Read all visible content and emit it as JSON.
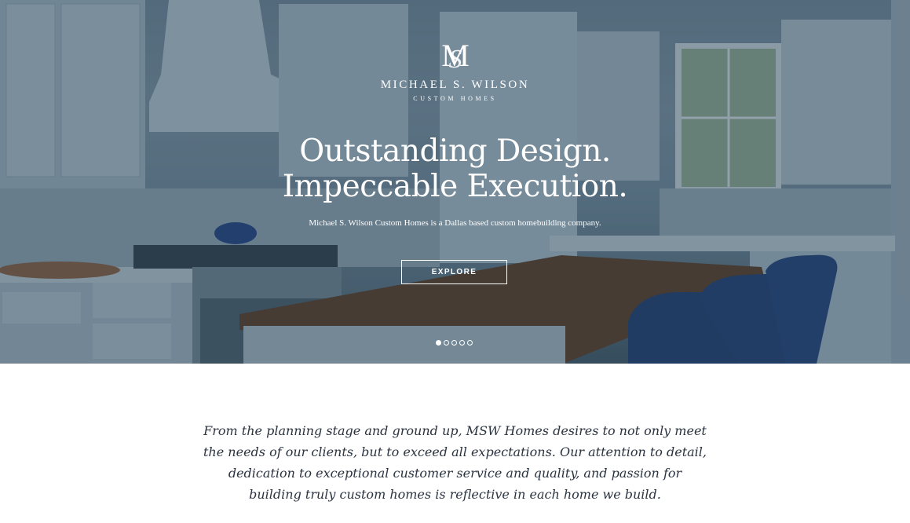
{
  "brand": {
    "monogram": "MSW",
    "name": "MICHAEL S. WILSON",
    "tagline": "CUSTOM HOMES"
  },
  "hero": {
    "headline_line1": "Outstanding Design.",
    "headline_line2": "Impeccable Execution.",
    "subline": "Michael S. Wilson Custom Homes is a Dallas based custom homebuilding company.",
    "cta_label": "EXPLORE",
    "slides": {
      "count": 5,
      "active": 1
    }
  },
  "intro": {
    "lines": [
      "From the planning stage and ground up, MSW Homes desires to not only meet",
      "the needs of our clients, but to exceed all expectations. Our attention to detail,",
      "dedication to exceptional customer service and quality, and passion for",
      "building truly custom homes is reflective in each home we build."
    ]
  },
  "colors": {
    "overlay": "#283e52",
    "text_dark": "#2a3340",
    "chair_blue": "#1c3a6e",
    "wood": "#5a3a22"
  }
}
